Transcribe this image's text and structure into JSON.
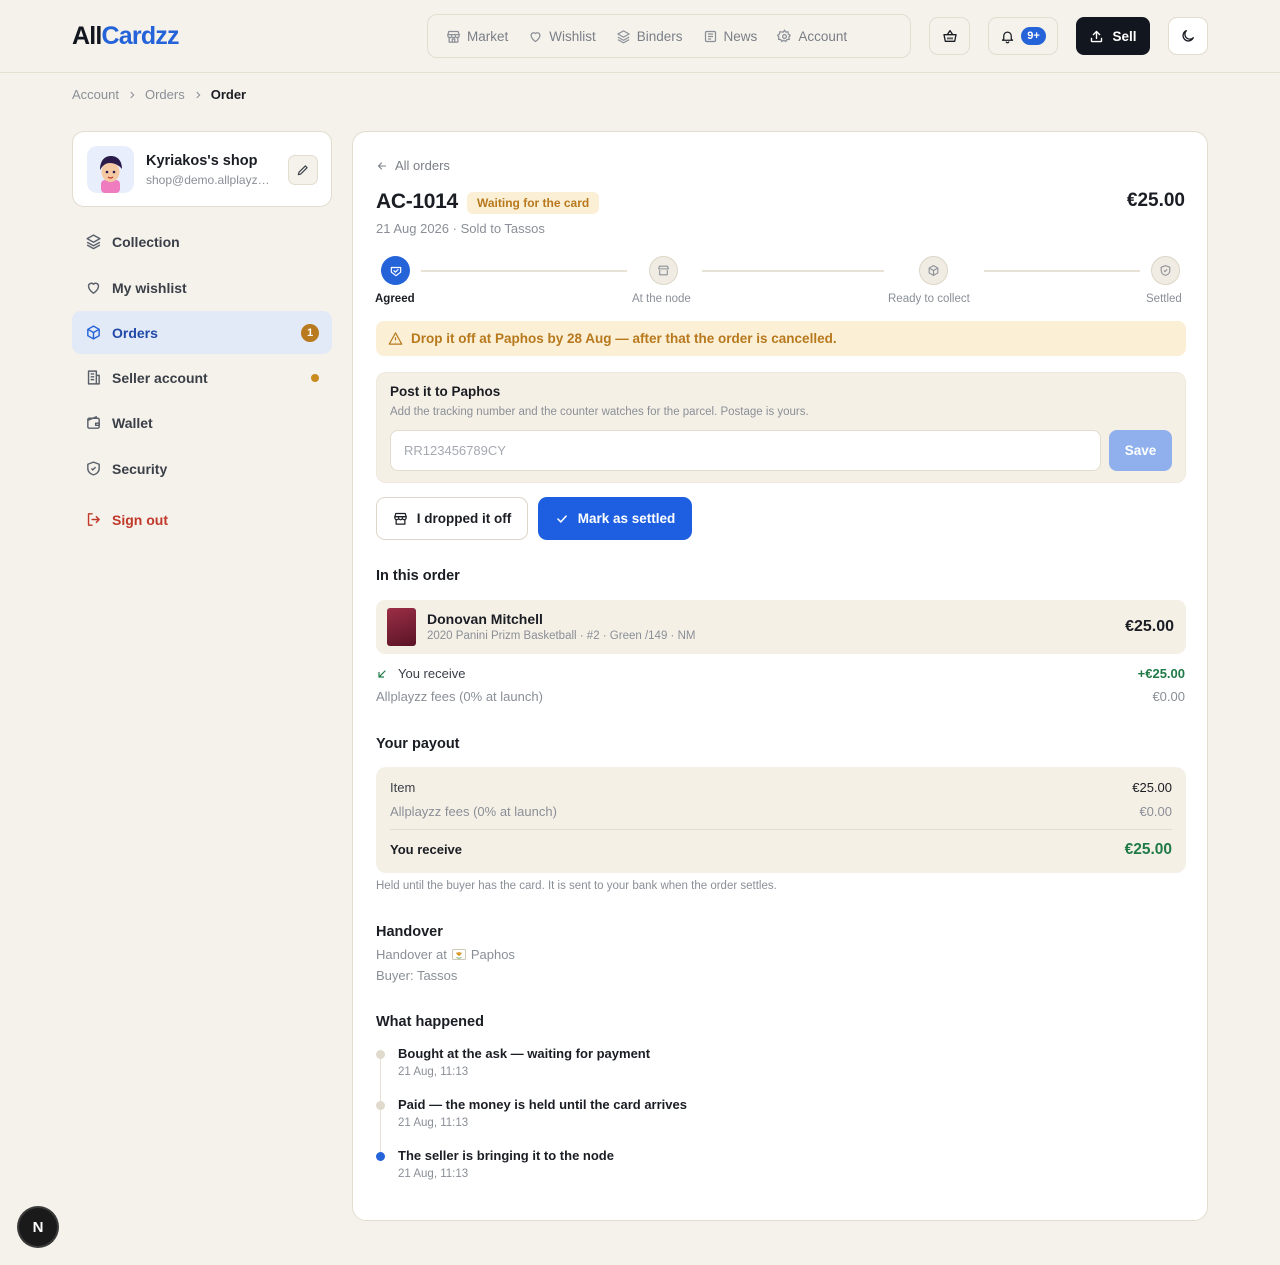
{
  "brand": {
    "part1": "All",
    "part2": "Cardzz"
  },
  "nav": [
    {
      "label": "Market",
      "icon": "store-icon"
    },
    {
      "label": "Wishlist",
      "icon": "heart-icon"
    },
    {
      "label": "Binders",
      "icon": "layers-icon"
    },
    {
      "label": "News",
      "icon": "newspaper-icon"
    },
    {
      "label": "Account",
      "icon": "gear-icon"
    }
  ],
  "header": {
    "notif_count": "9+",
    "sell_label": "Sell"
  },
  "breadcrumb": {
    "account": "Account",
    "orders": "Orders",
    "order": "Order"
  },
  "shop": {
    "name": "Kyriakos's shop",
    "email": "shop@demo.allplayzz.com"
  },
  "sidebar": {
    "items": [
      {
        "label": "Collection"
      },
      {
        "label": "My wishlist"
      },
      {
        "label": "Orders",
        "badge": "1"
      },
      {
        "label": "Seller account"
      },
      {
        "label": "Wallet"
      },
      {
        "label": "Security"
      }
    ],
    "signout": "Sign out"
  },
  "order": {
    "back_label": "All orders",
    "id": "AC-1014",
    "status": "Waiting for the card",
    "price": "€25.00",
    "subtitle": "21 Aug 2026 · Sold to Tassos",
    "steps": [
      "Agreed",
      "At the node",
      "Ready to collect",
      "Settled"
    ],
    "warning": "Drop it off at Paphos by 28 Aug — after that the order is cancelled.",
    "post": {
      "title": "Post it to Paphos",
      "desc": "Add the tracking number and the counter watches for the parcel. Postage is yours.",
      "placeholder": "RR123456789CY",
      "save": "Save"
    },
    "actions": {
      "dropped": "I dropped it off",
      "settled": "Mark as settled"
    },
    "in_order_title": "In this order",
    "item": {
      "name": "Donovan Mitchell",
      "meta": "2020 Panini Prizm Basketball · #2 · Green /149 · NM",
      "price": "€25.00"
    },
    "receive_label": "You receive",
    "receive_value": "+€25.00",
    "fees_label": "Allplayzz fees (0% at launch)",
    "fees_value": "€0.00"
  },
  "payout": {
    "title": "Your payout",
    "item_label": "Item",
    "item_value": "€25.00",
    "fees_label": "Allplayzz fees (0% at launch)",
    "fees_value": "€0.00",
    "total_label": "You receive",
    "total_value": "€25.00",
    "note": "Held until the buyer has the card. It is sent to your bank when the order settles."
  },
  "handover": {
    "title": "Handover",
    "location_prefix": "Handover at",
    "location": "Paphos",
    "buyer": "Buyer: Tassos"
  },
  "history": {
    "title": "What happened",
    "events": [
      {
        "title": "Bought at the ask — waiting for payment",
        "time": "21 Aug, 11:13"
      },
      {
        "title": "Paid — the money is held until the card arrives",
        "time": "21 Aug, 11:13"
      },
      {
        "title": "The seller is bringing it to the node",
        "time": "21 Aug, 11:13"
      }
    ]
  },
  "dev_badge": "N",
  "colors": {
    "accent": "#2563d9",
    "warning": "#b8791d",
    "positive": "#1f7a47",
    "danger": "#c0392b"
  }
}
